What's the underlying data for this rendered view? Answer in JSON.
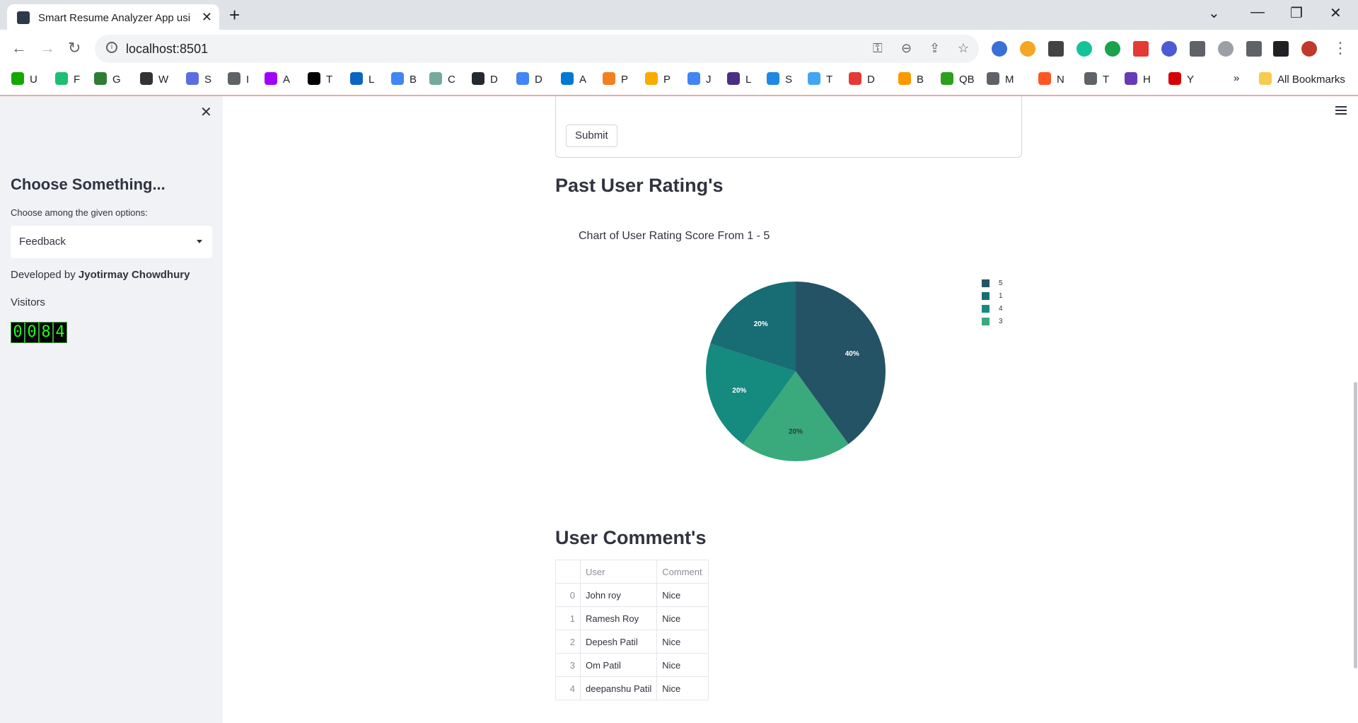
{
  "browser": {
    "tab_title": "Smart Resume Analyzer App usi",
    "new_tab": "+",
    "url": "localhost:8501",
    "bookmarks": [
      {
        "label": "U",
        "color": "#14a800"
      },
      {
        "label": "F",
        "color": "#1dbf73"
      },
      {
        "label": "G",
        "color": "#2e7d32"
      },
      {
        "label": "W",
        "color": "#333333"
      },
      {
        "label": "S",
        "color": "#5b6ee1"
      },
      {
        "label": "I",
        "color": "#5f6368"
      },
      {
        "label": "A",
        "color": "#a100ff"
      },
      {
        "label": "T",
        "color": "#000000"
      },
      {
        "label": "L",
        "color": "#0a66c2"
      },
      {
        "label": "B",
        "color": "#4285f4"
      },
      {
        "label": "C",
        "color": "#74aa9c"
      },
      {
        "label": "D",
        "color": "#24292f"
      },
      {
        "label": "D",
        "color": "#4285f4"
      },
      {
        "label": "A",
        "color": "#0078d4"
      },
      {
        "label": "P",
        "color": "#f38020"
      },
      {
        "label": "P",
        "color": "#f9ab00"
      },
      {
        "label": "J",
        "color": "#4285f4"
      },
      {
        "label": "L",
        "color": "#4b2e83"
      },
      {
        "label": "S",
        "color": "#1e88e5"
      },
      {
        "label": "T",
        "color": "#42a5f5"
      },
      {
        "label": "D",
        "color": "#e53935"
      },
      {
        "label": "B",
        "color": "#ff9800"
      },
      {
        "label": "QB",
        "color": "#2ca01c"
      },
      {
        "label": "M",
        "color": "#5f6368"
      },
      {
        "label": "N",
        "color": "#ff5722"
      },
      {
        "label": "T",
        "color": "#5f6368"
      },
      {
        "label": "H",
        "color": "#673ab7"
      },
      {
        "label": "Y",
        "color": "#d50000"
      }
    ],
    "more_bookmarks": "»",
    "all_bookmarks": "All Bookmarks"
  },
  "sidebar": {
    "close": "✕",
    "heading": "Choose Something...",
    "select_label": "Choose among the given options:",
    "select_value": "Feedback",
    "developed_prefix": "Developed by ",
    "developer_name": "Jyotirmay Chowdhury",
    "visitors_label": "Visitors",
    "visitor_count": "0084"
  },
  "main": {
    "submit_label": "Submit",
    "ratings_heading": "Past User Rating's",
    "comments_heading": "User Comment's"
  },
  "chart_data": {
    "type": "pie",
    "title": "Chart of User Rating Score From 1 - 5",
    "slices": [
      {
        "label": "5",
        "value": 40,
        "color": "#245365"
      },
      {
        "label": "1",
        "value": 20,
        "color": "#176d73"
      },
      {
        "label": "4",
        "value": 20,
        "color": "#158a7f"
      },
      {
        "label": "3",
        "value": 20,
        "color": "#3aa97c"
      }
    ],
    "slice_label_order": [
      "5",
      "3",
      "4",
      "1"
    ],
    "legend_placement": "right"
  },
  "comments_table": {
    "columns": [
      "",
      "User",
      "Comment"
    ],
    "rows": [
      {
        "index": "0",
        "user": "John roy",
        "comment": "Nice"
      },
      {
        "index": "1",
        "user": "Ramesh Roy",
        "comment": "Nice"
      },
      {
        "index": "2",
        "user": "Depesh Patil",
        "comment": "Nice"
      },
      {
        "index": "3",
        "user": "Om Patil",
        "comment": "Nice"
      },
      {
        "index": "4",
        "user": "deepanshu Patil",
        "comment": "Nice"
      }
    ]
  }
}
